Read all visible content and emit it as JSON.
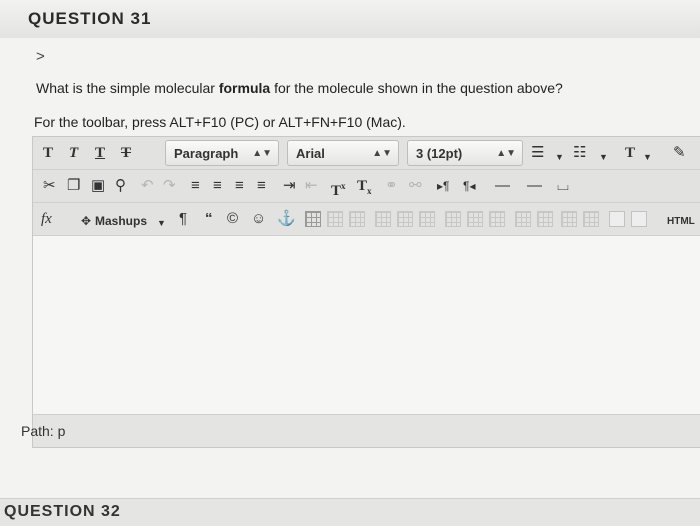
{
  "question": {
    "title": "QUESTION 31",
    "chevron": ">",
    "text_before": "What is the simple molecular ",
    "text_bold": "formula",
    "text_after": " for the molecule shown in the question above?",
    "toolbar_help": "For the toolbar, press ALT+F10 (PC) or ALT+FN+F10 (Mac)."
  },
  "toolbar": {
    "paragraph_select": "Paragraph",
    "font_select": "Arial",
    "size_select": "3 (12pt)",
    "mashups_label": "Mashups",
    "html_label": "HTML",
    "format_labels": [
      "T",
      "T",
      "T",
      "T"
    ],
    "superscript": "T",
    "subscript": "T",
    "fx": "fx"
  },
  "editor": {
    "path_label": "Path: p"
  },
  "next_question": {
    "title": "QUESTION 32"
  },
  "icons": [
    "bold-icon",
    "italic-icon",
    "underline-icon",
    "strikethrough-icon",
    "cut-icon",
    "copy-icon",
    "paste-icon",
    "find-icon",
    "undo-icon",
    "redo-icon",
    "align-left-icon",
    "align-center-icon",
    "align-right-icon",
    "justify-icon",
    "indent-icon",
    "outdent-icon",
    "superscript-icon",
    "subscript-icon",
    "link-icon",
    "unlink-icon",
    "ltr-icon",
    "rtl-icon",
    "hr-icon",
    "pilcrow-icon",
    "quote-icon",
    "copyright-icon",
    "emoticon-icon",
    "anchor-icon",
    "table-icon",
    "html-icon"
  ]
}
